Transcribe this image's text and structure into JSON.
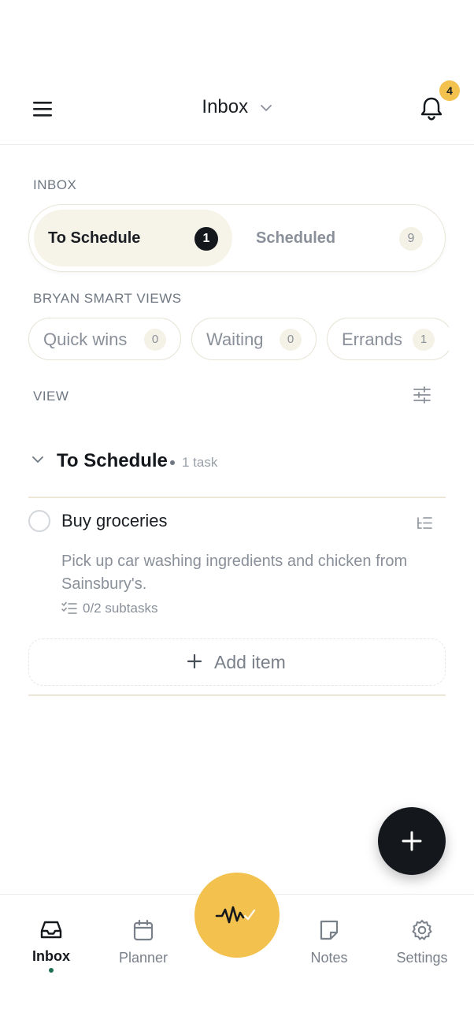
{
  "header": {
    "title": "Inbox",
    "notification_count": "4"
  },
  "inbox_section": {
    "label": "INBOX",
    "tabs": [
      {
        "label": "To Schedule",
        "count": "1",
        "active": true
      },
      {
        "label": "Scheduled",
        "count": "9",
        "active": false
      }
    ]
  },
  "smart_views": {
    "label": "BRYAN SMART VIEWS",
    "items": [
      {
        "label": "Quick wins",
        "count": "0"
      },
      {
        "label": "Waiting",
        "count": "0"
      },
      {
        "label": "Errands",
        "count": "1"
      }
    ]
  },
  "view": {
    "label": "VIEW"
  },
  "group": {
    "title": "To Schedule",
    "task_count": "1 task"
  },
  "tasks": [
    {
      "title": "Buy groceries",
      "description": "Pick up car washing ingredients and chicken from Sainsbury's.",
      "subtasks": "0/2 subtasks"
    }
  ],
  "add_item": {
    "label": "Add item"
  },
  "bottom_nav": {
    "items": [
      {
        "label": "Inbox",
        "icon": "inbox-icon",
        "active": true
      },
      {
        "label": "Planner",
        "icon": "calendar-icon",
        "active": false
      },
      {
        "label": "Notes",
        "icon": "note-icon",
        "active": false
      },
      {
        "label": "Settings",
        "icon": "gear-icon",
        "active": false
      }
    ],
    "center_icon": "waveform-check-icon"
  },
  "colors": {
    "accent_yellow": "#f2c14e",
    "dark": "#14181d",
    "cream": "#f6f3e8",
    "active_dot": "#1f6f55"
  }
}
